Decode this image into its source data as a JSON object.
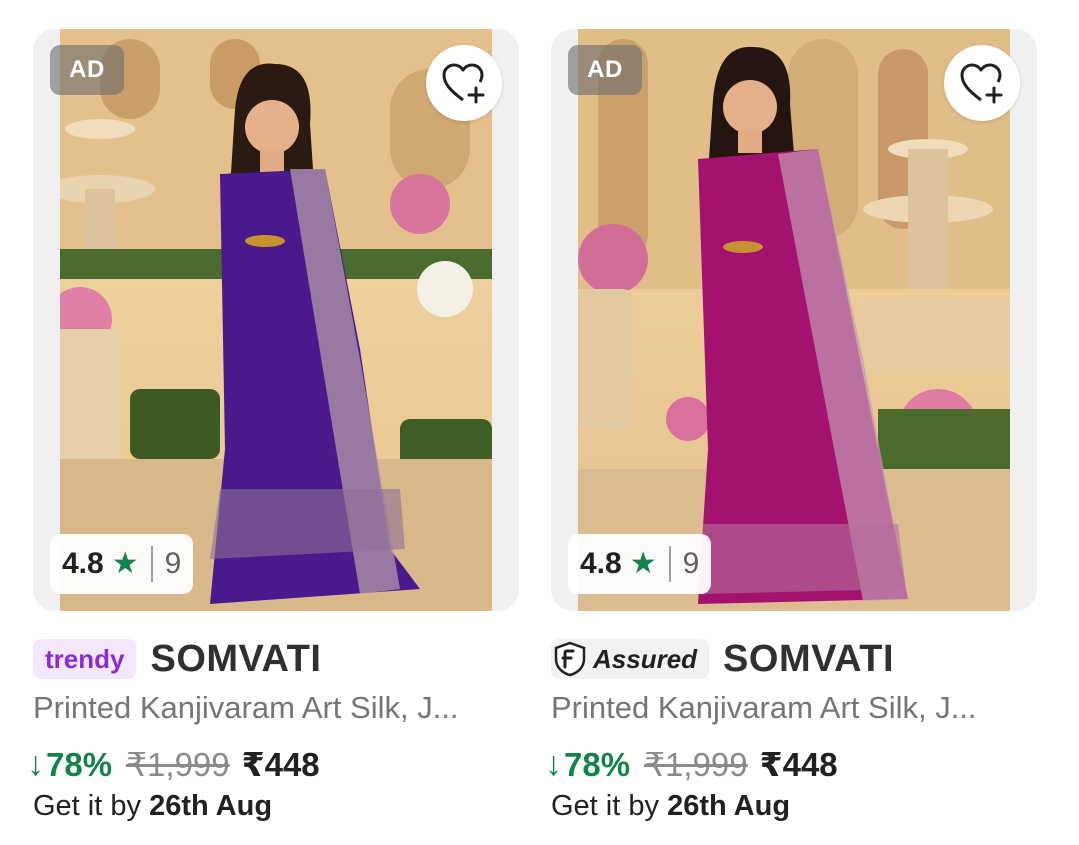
{
  "products": [
    {
      "ad_label": "AD",
      "rating": "4.8",
      "rating_count": "9",
      "tag_label": "trendy",
      "brand": "SOMVATI",
      "title": "Printed Kanjivaram Art Silk, J...",
      "discount": "78%",
      "mrp": "₹1,999",
      "price": "₹448",
      "delivery_prefix": "Get it by",
      "delivery_date": "26th Aug",
      "saree_color": "#4a1a8c"
    },
    {
      "ad_label": "AD",
      "rating": "4.8",
      "rating_count": "9",
      "tag_label": "Assured",
      "brand": "SOMVATI",
      "title": "Printed Kanjivaram Art Silk, J...",
      "discount": "78%",
      "mrp": "₹1,999",
      "price": "₹448",
      "delivery_prefix": "Get it by",
      "delivery_date": "26th Aug",
      "saree_color": "#a3126e"
    }
  ],
  "colors": {
    "discount_green": "#14834a",
    "star_green": "#14834a",
    "trendy_purple": "#8b2ad6",
    "trendy_bg": "#f4e8ff"
  },
  "icons": {
    "wishlist": "heart-plus-icon",
    "rating": "star-icon",
    "discount": "arrow-down-icon",
    "assured": "flipkart-assured-shield-icon"
  }
}
